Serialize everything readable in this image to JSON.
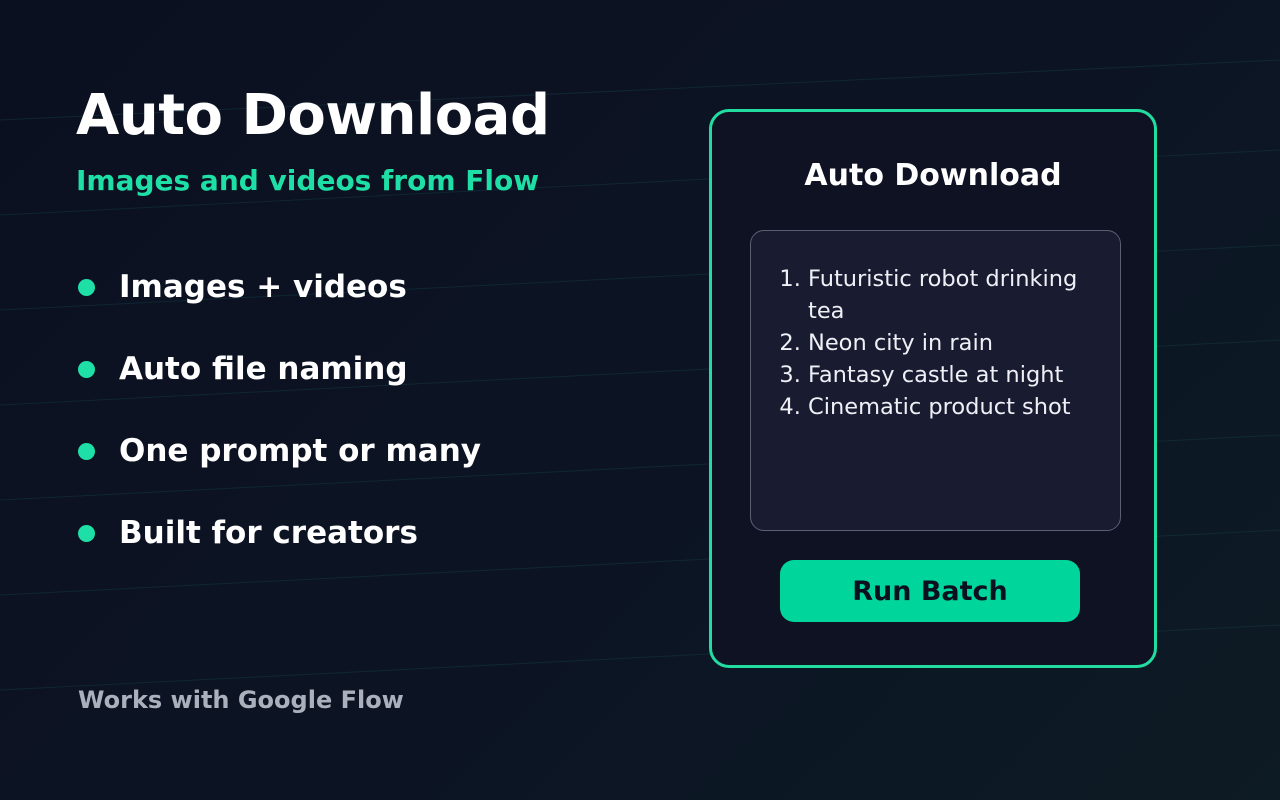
{
  "hero": {
    "title": "Auto Download",
    "subtitle": "Images and videos from Flow"
  },
  "features": [
    {
      "label": "Images + videos"
    },
    {
      "label": "Auto file naming"
    },
    {
      "label": "One prompt or many"
    },
    {
      "label": "Built for creators"
    }
  ],
  "footer": {
    "note": "Works with Google Flow"
  },
  "panel": {
    "title": "Auto Download",
    "prompts": [
      "Futuristic robot drinking tea",
      "Neon city in rain",
      "Fantasy castle at night",
      "Cinematic product shot"
    ],
    "button_label": "Run Batch"
  },
  "colors": {
    "accent": "#1ee0a6",
    "button": "#00d69b",
    "background": "#0b1020",
    "panel": "#0e1222",
    "prompt_box": "#191b30",
    "muted_text": "#aab0bc"
  }
}
